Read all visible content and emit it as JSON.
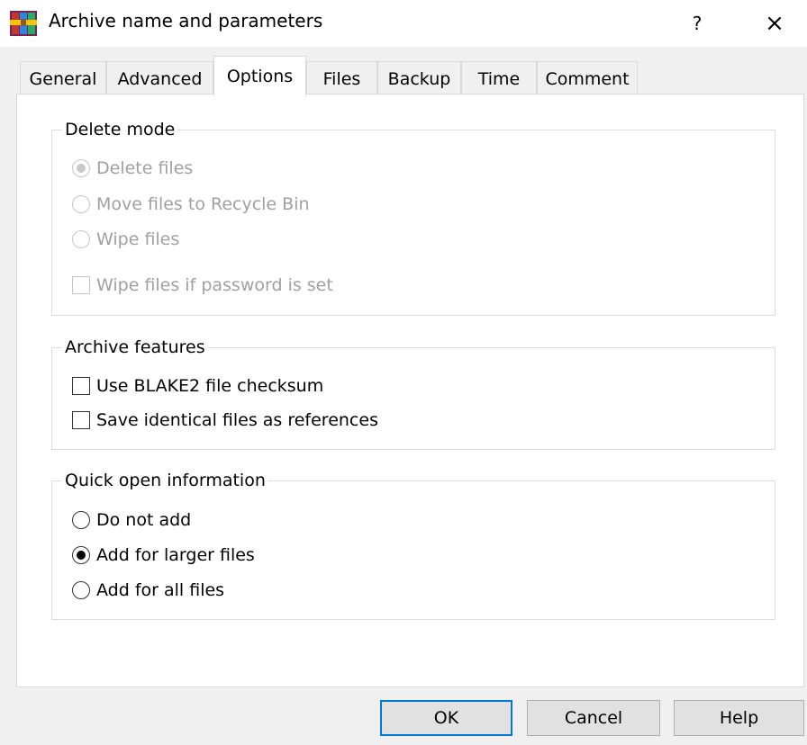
{
  "window": {
    "title": "Archive name and parameters",
    "help_label": "?",
    "close_label": "×"
  },
  "tabs": [
    {
      "label": "General"
    },
    {
      "label": "Advanced"
    },
    {
      "label": "Options",
      "active": true
    },
    {
      "label": "Files"
    },
    {
      "label": "Backup"
    },
    {
      "label": "Time"
    },
    {
      "label": "Comment"
    }
  ],
  "delete_mode": {
    "label": "Delete mode",
    "enabled": false,
    "options": [
      {
        "label": "Delete files",
        "selected": true
      },
      {
        "label": "Move files to Recycle Bin",
        "selected": false
      },
      {
        "label": "Wipe files",
        "selected": false
      }
    ],
    "wipe_password": {
      "label": "Wipe files if password is set",
      "checked": false
    }
  },
  "archive_features": {
    "label": "Archive features",
    "blake2": {
      "label": "Use BLAKE2 file checksum",
      "checked": false
    },
    "references": {
      "label": "Save identical files as references",
      "checked": false
    }
  },
  "quick_open": {
    "label": "Quick open information",
    "options": [
      {
        "label": "Do not add",
        "selected": false
      },
      {
        "label": "Add for larger files",
        "selected": true
      },
      {
        "label": "Add for all files",
        "selected": false
      }
    ]
  },
  "buttons": {
    "ok": "OK",
    "cancel": "Cancel",
    "help": "Help"
  },
  "colors": {
    "accent": "#0078d7",
    "disabled_text": "#a0a0a0"
  }
}
